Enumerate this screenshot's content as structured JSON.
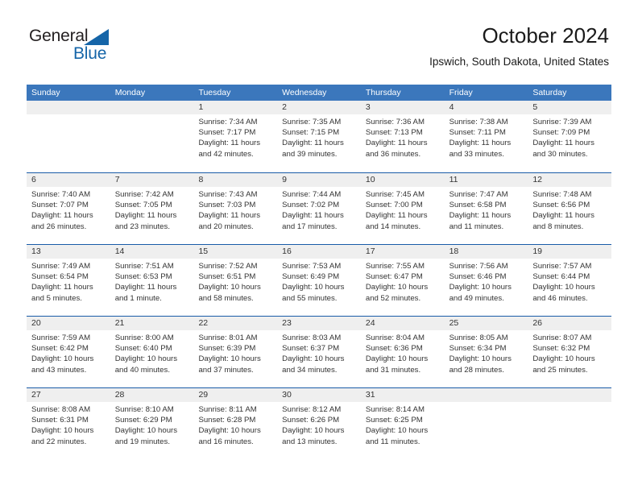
{
  "brand": {
    "name_part1": "General",
    "name_part2": "Blue",
    "triangle_icon": "triangle-icon",
    "accent_color": "#1565a8"
  },
  "header": {
    "title": "October 2024",
    "subtitle": "Ipswich, South Dakota, United States"
  },
  "calendar": {
    "header_bg": "#3b77bc",
    "row_divider": "#1a5ca8",
    "daynum_band_bg": "#efefef",
    "weekdays": [
      "Sunday",
      "Monday",
      "Tuesday",
      "Wednesday",
      "Thursday",
      "Friday",
      "Saturday"
    ],
    "weeks": [
      [
        {
          "day": "",
          "sunrise": "",
          "sunset": "",
          "daylight": ""
        },
        {
          "day": "",
          "sunrise": "",
          "sunset": "",
          "daylight": ""
        },
        {
          "day": "1",
          "sunrise": "Sunrise: 7:34 AM",
          "sunset": "Sunset: 7:17 PM",
          "daylight": "Daylight: 11 hours and 42 minutes."
        },
        {
          "day": "2",
          "sunrise": "Sunrise: 7:35 AM",
          "sunset": "Sunset: 7:15 PM",
          "daylight": "Daylight: 11 hours and 39 minutes."
        },
        {
          "day": "3",
          "sunrise": "Sunrise: 7:36 AM",
          "sunset": "Sunset: 7:13 PM",
          "daylight": "Daylight: 11 hours and 36 minutes."
        },
        {
          "day": "4",
          "sunrise": "Sunrise: 7:38 AM",
          "sunset": "Sunset: 7:11 PM",
          "daylight": "Daylight: 11 hours and 33 minutes."
        },
        {
          "day": "5",
          "sunrise": "Sunrise: 7:39 AM",
          "sunset": "Sunset: 7:09 PM",
          "daylight": "Daylight: 11 hours and 30 minutes."
        }
      ],
      [
        {
          "day": "6",
          "sunrise": "Sunrise: 7:40 AM",
          "sunset": "Sunset: 7:07 PM",
          "daylight": "Daylight: 11 hours and 26 minutes."
        },
        {
          "day": "7",
          "sunrise": "Sunrise: 7:42 AM",
          "sunset": "Sunset: 7:05 PM",
          "daylight": "Daylight: 11 hours and 23 minutes."
        },
        {
          "day": "8",
          "sunrise": "Sunrise: 7:43 AM",
          "sunset": "Sunset: 7:03 PM",
          "daylight": "Daylight: 11 hours and 20 minutes."
        },
        {
          "day": "9",
          "sunrise": "Sunrise: 7:44 AM",
          "sunset": "Sunset: 7:02 PM",
          "daylight": "Daylight: 11 hours and 17 minutes."
        },
        {
          "day": "10",
          "sunrise": "Sunrise: 7:45 AM",
          "sunset": "Sunset: 7:00 PM",
          "daylight": "Daylight: 11 hours and 14 minutes."
        },
        {
          "day": "11",
          "sunrise": "Sunrise: 7:47 AM",
          "sunset": "Sunset: 6:58 PM",
          "daylight": "Daylight: 11 hours and 11 minutes."
        },
        {
          "day": "12",
          "sunrise": "Sunrise: 7:48 AM",
          "sunset": "Sunset: 6:56 PM",
          "daylight": "Daylight: 11 hours and 8 minutes."
        }
      ],
      [
        {
          "day": "13",
          "sunrise": "Sunrise: 7:49 AM",
          "sunset": "Sunset: 6:54 PM",
          "daylight": "Daylight: 11 hours and 5 minutes."
        },
        {
          "day": "14",
          "sunrise": "Sunrise: 7:51 AM",
          "sunset": "Sunset: 6:53 PM",
          "daylight": "Daylight: 11 hours and 1 minute."
        },
        {
          "day": "15",
          "sunrise": "Sunrise: 7:52 AM",
          "sunset": "Sunset: 6:51 PM",
          "daylight": "Daylight: 10 hours and 58 minutes."
        },
        {
          "day": "16",
          "sunrise": "Sunrise: 7:53 AM",
          "sunset": "Sunset: 6:49 PM",
          "daylight": "Daylight: 10 hours and 55 minutes."
        },
        {
          "day": "17",
          "sunrise": "Sunrise: 7:55 AM",
          "sunset": "Sunset: 6:47 PM",
          "daylight": "Daylight: 10 hours and 52 minutes."
        },
        {
          "day": "18",
          "sunrise": "Sunrise: 7:56 AM",
          "sunset": "Sunset: 6:46 PM",
          "daylight": "Daylight: 10 hours and 49 minutes."
        },
        {
          "day": "19",
          "sunrise": "Sunrise: 7:57 AM",
          "sunset": "Sunset: 6:44 PM",
          "daylight": "Daylight: 10 hours and 46 minutes."
        }
      ],
      [
        {
          "day": "20",
          "sunrise": "Sunrise: 7:59 AM",
          "sunset": "Sunset: 6:42 PM",
          "daylight": "Daylight: 10 hours and 43 minutes."
        },
        {
          "day": "21",
          "sunrise": "Sunrise: 8:00 AM",
          "sunset": "Sunset: 6:40 PM",
          "daylight": "Daylight: 10 hours and 40 minutes."
        },
        {
          "day": "22",
          "sunrise": "Sunrise: 8:01 AM",
          "sunset": "Sunset: 6:39 PM",
          "daylight": "Daylight: 10 hours and 37 minutes."
        },
        {
          "day": "23",
          "sunrise": "Sunrise: 8:03 AM",
          "sunset": "Sunset: 6:37 PM",
          "daylight": "Daylight: 10 hours and 34 minutes."
        },
        {
          "day": "24",
          "sunrise": "Sunrise: 8:04 AM",
          "sunset": "Sunset: 6:36 PM",
          "daylight": "Daylight: 10 hours and 31 minutes."
        },
        {
          "day": "25",
          "sunrise": "Sunrise: 8:05 AM",
          "sunset": "Sunset: 6:34 PM",
          "daylight": "Daylight: 10 hours and 28 minutes."
        },
        {
          "day": "26",
          "sunrise": "Sunrise: 8:07 AM",
          "sunset": "Sunset: 6:32 PM",
          "daylight": "Daylight: 10 hours and 25 minutes."
        }
      ],
      [
        {
          "day": "27",
          "sunrise": "Sunrise: 8:08 AM",
          "sunset": "Sunset: 6:31 PM",
          "daylight": "Daylight: 10 hours and 22 minutes."
        },
        {
          "day": "28",
          "sunrise": "Sunrise: 8:10 AM",
          "sunset": "Sunset: 6:29 PM",
          "daylight": "Daylight: 10 hours and 19 minutes."
        },
        {
          "day": "29",
          "sunrise": "Sunrise: 8:11 AM",
          "sunset": "Sunset: 6:28 PM",
          "daylight": "Daylight: 10 hours and 16 minutes."
        },
        {
          "day": "30",
          "sunrise": "Sunrise: 8:12 AM",
          "sunset": "Sunset: 6:26 PM",
          "daylight": "Daylight: 10 hours and 13 minutes."
        },
        {
          "day": "31",
          "sunrise": "Sunrise: 8:14 AM",
          "sunset": "Sunset: 6:25 PM",
          "daylight": "Daylight: 10 hours and 11 minutes."
        },
        {
          "day": "",
          "sunrise": "",
          "sunset": "",
          "daylight": ""
        },
        {
          "day": "",
          "sunrise": "",
          "sunset": "",
          "daylight": ""
        }
      ]
    ]
  }
}
